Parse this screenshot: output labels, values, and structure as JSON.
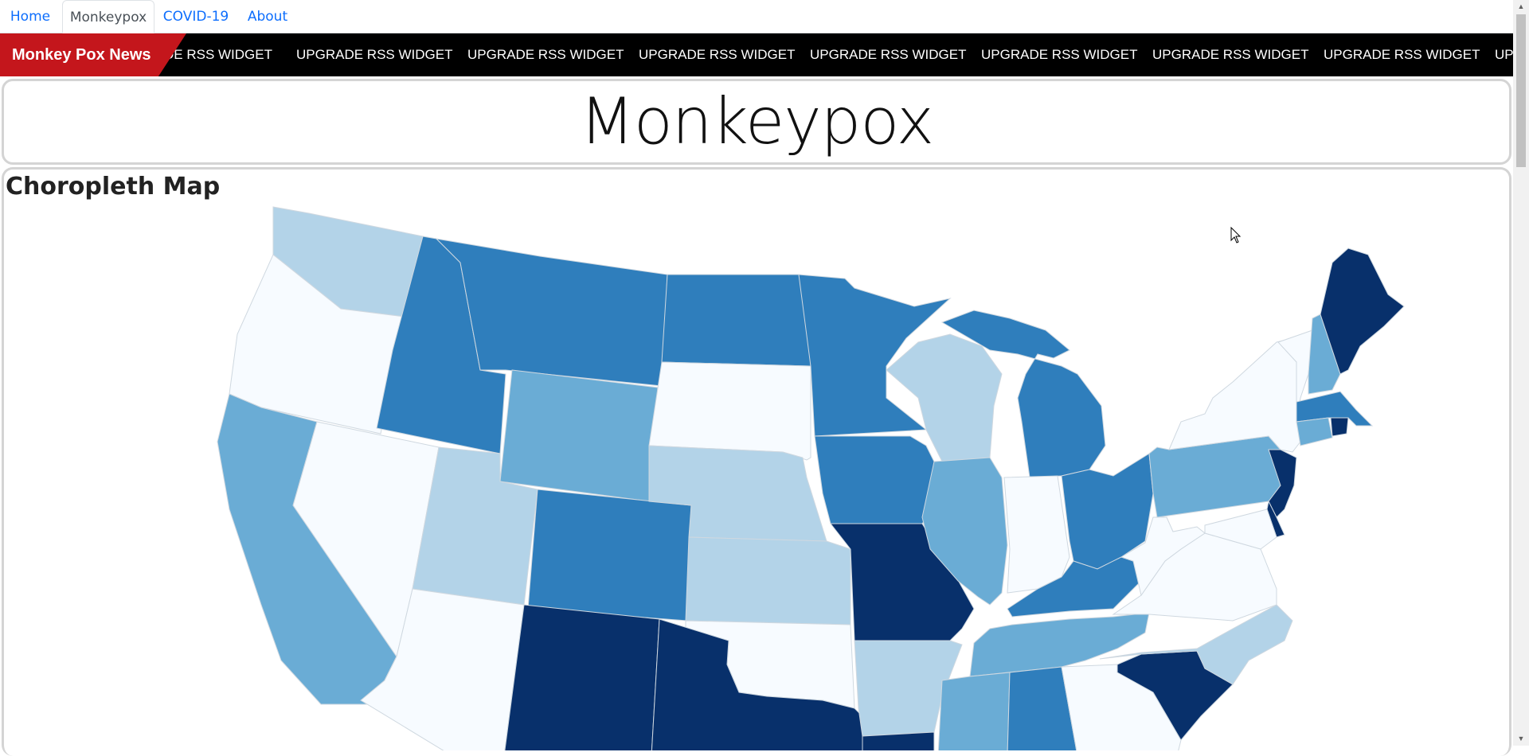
{
  "nav": {
    "tabs": [
      {
        "label": "Home",
        "active": false
      },
      {
        "label": "Monkeypox",
        "active": true
      },
      {
        "label": "COVID-19",
        "active": false
      },
      {
        "label": "About",
        "active": false
      }
    ]
  },
  "ticker": {
    "label": "Monkey Pox News",
    "items": [
      "DE RSS WIDGET",
      "UPGRADE RSS WIDGET",
      "UPGRADE RSS WIDGET",
      "UPGRADE RSS WIDGET",
      "UPGRADE RSS WIDGET",
      "UPGRADE RSS WIDGET",
      "UPGRADE RSS WIDGET",
      "UPGRADE RSS WIDGET",
      "UPG"
    ]
  },
  "page": {
    "title": "Monkeypox"
  },
  "map": {
    "heading": "Choropleth Map",
    "palette": [
      "#f7fbff",
      "#b3d3e8",
      "#6aacd5",
      "#2f7ebc",
      "#08306b"
    ],
    "states": [
      {
        "id": "WA",
        "level": 1
      },
      {
        "id": "OR",
        "level": 0
      },
      {
        "id": "CA",
        "level": 2
      },
      {
        "id": "NV",
        "level": 0
      },
      {
        "id": "ID",
        "level": 3
      },
      {
        "id": "MT",
        "level": 3
      },
      {
        "id": "WY",
        "level": 2
      },
      {
        "id": "UT",
        "level": 1
      },
      {
        "id": "AZ",
        "level": 0
      },
      {
        "id": "CO",
        "level": 3
      },
      {
        "id": "NM",
        "level": 4
      },
      {
        "id": "ND",
        "level": 3
      },
      {
        "id": "SD",
        "level": 0
      },
      {
        "id": "NE",
        "level": 1
      },
      {
        "id": "KS",
        "level": 1
      },
      {
        "id": "OK",
        "level": 0
      },
      {
        "id": "TX",
        "level": 4
      },
      {
        "id": "MN",
        "level": 3
      },
      {
        "id": "IA",
        "level": 3
      },
      {
        "id": "MO",
        "level": 4
      },
      {
        "id": "AR",
        "level": 1
      },
      {
        "id": "LA",
        "level": 4
      },
      {
        "id": "WI",
        "level": 1
      },
      {
        "id": "IL",
        "level": 2
      },
      {
        "id": "MI",
        "level": 3
      },
      {
        "id": "IN",
        "level": 0
      },
      {
        "id": "OH",
        "level": 3
      },
      {
        "id": "KY",
        "level": 3
      },
      {
        "id": "TN",
        "level": 2
      },
      {
        "id": "MS",
        "level": 2
      },
      {
        "id": "AL",
        "level": 3
      },
      {
        "id": "GA",
        "level": 0
      },
      {
        "id": "SC",
        "level": 4
      },
      {
        "id": "NC",
        "level": 1
      },
      {
        "id": "VA",
        "level": 0
      },
      {
        "id": "WV",
        "level": 0
      },
      {
        "id": "PA",
        "level": 2
      },
      {
        "id": "NY",
        "level": 0
      },
      {
        "id": "NJ",
        "level": 4
      },
      {
        "id": "DE",
        "level": 4
      },
      {
        "id": "MD",
        "level": 0
      },
      {
        "id": "VT",
        "level": 0
      },
      {
        "id": "NH",
        "level": 2
      },
      {
        "id": "ME",
        "level": 4
      },
      {
        "id": "MA",
        "level": 3
      },
      {
        "id": "CT",
        "level": 2
      },
      {
        "id": "RI",
        "level": 4
      }
    ]
  }
}
